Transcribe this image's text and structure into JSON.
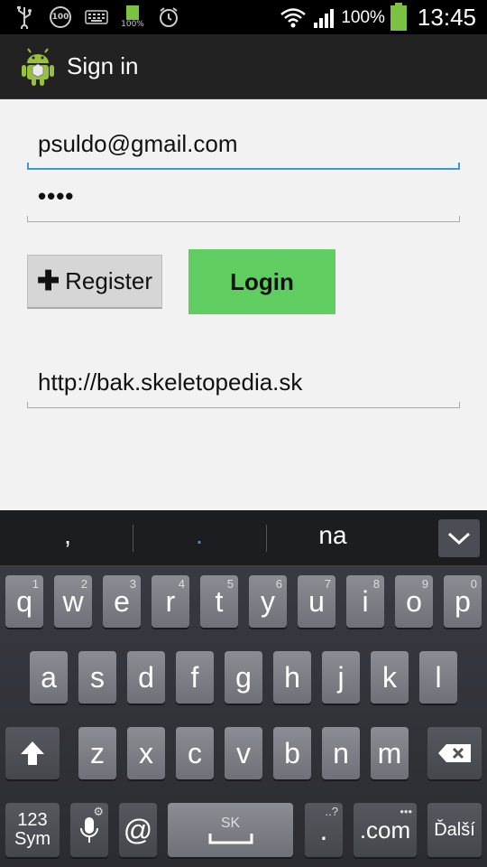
{
  "status_bar": {
    "icons": [
      "usb-icon",
      "notification-100-icon",
      "keyboard-icon",
      "battery-full-icon",
      "alarm-icon"
    ],
    "notification_badge": "100",
    "battery_small_label": "100%",
    "battery_percent": "100%",
    "time": "13:45"
  },
  "action_bar": {
    "title": "Sign in"
  },
  "form": {
    "email_value": "psuldo@gmail.com",
    "password_value": "••••",
    "register_label": "Register",
    "login_label": "Login",
    "server_url_value": "http://bak.skeletopedia.sk"
  },
  "colors": {
    "accent": "#3a9ad1",
    "login_green": "#5fcd5f",
    "battery_green": "#7cc242"
  },
  "keyboard": {
    "suggestions": [
      ",",
      ".",
      "na"
    ],
    "row1": [
      {
        "key": "q",
        "sup": "1"
      },
      {
        "key": "w",
        "sup": "2"
      },
      {
        "key": "e",
        "sup": "3"
      },
      {
        "key": "r",
        "sup": "4"
      },
      {
        "key": "t",
        "sup": "5"
      },
      {
        "key": "y",
        "sup": "6"
      },
      {
        "key": "u",
        "sup": "7"
      },
      {
        "key": "i",
        "sup": "8"
      },
      {
        "key": "o",
        "sup": "9"
      },
      {
        "key": "p",
        "sup": "0"
      }
    ],
    "row2": [
      "a",
      "s",
      "d",
      "f",
      "g",
      "h",
      "j",
      "k",
      "l"
    ],
    "row3": [
      "z",
      "x",
      "c",
      "v",
      "b",
      "n",
      "m"
    ],
    "sym_label_1": "123",
    "sym_label_2": "Sym",
    "at_label": "@",
    "space_label": "SK",
    "period_label": ".",
    "period_sup": "..?",
    "dotcom_label": ".com",
    "next_label": "Ďalší"
  }
}
